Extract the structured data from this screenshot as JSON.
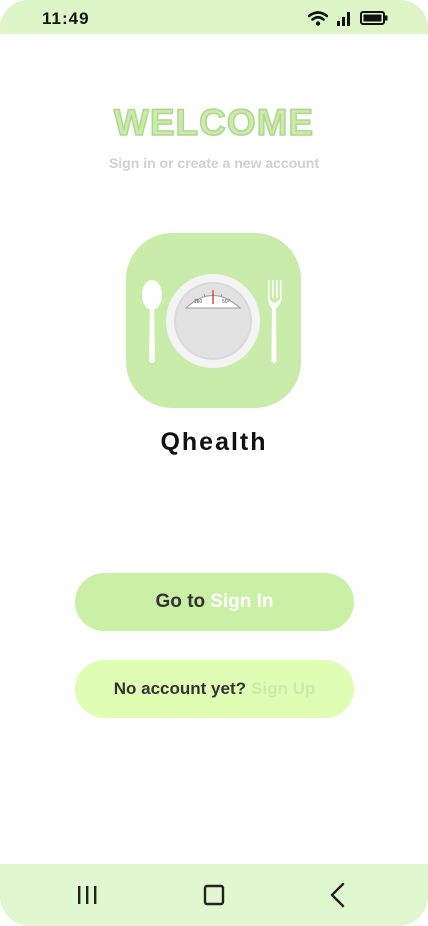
{
  "status_bar": {
    "time": "11:49",
    "icons": [
      "wifi-icon",
      "signal-icon",
      "battery-icon"
    ]
  },
  "header": {
    "title": "WELCOME",
    "subtitle": "Sign in or create a new account"
  },
  "logo": {
    "icon": "plate-scale-icon",
    "scale_reading_left": "150",
    "scale_reading_right": "50"
  },
  "app": {
    "name": "Qhealth"
  },
  "buttons": {
    "signin_prefix": "Go to",
    "signin_accent": "Sign In",
    "signup_prefix": "No account yet?",
    "signup_accent": "Sign Up"
  },
  "nav": {
    "items": [
      "recents-icon",
      "home-icon",
      "back-icon"
    ]
  },
  "colors": {
    "accent_green": "#c9ecaa",
    "button_primary": "#c9f0a4",
    "button_secondary": "#e0fdb4",
    "bars": "#ddf5c6"
  }
}
